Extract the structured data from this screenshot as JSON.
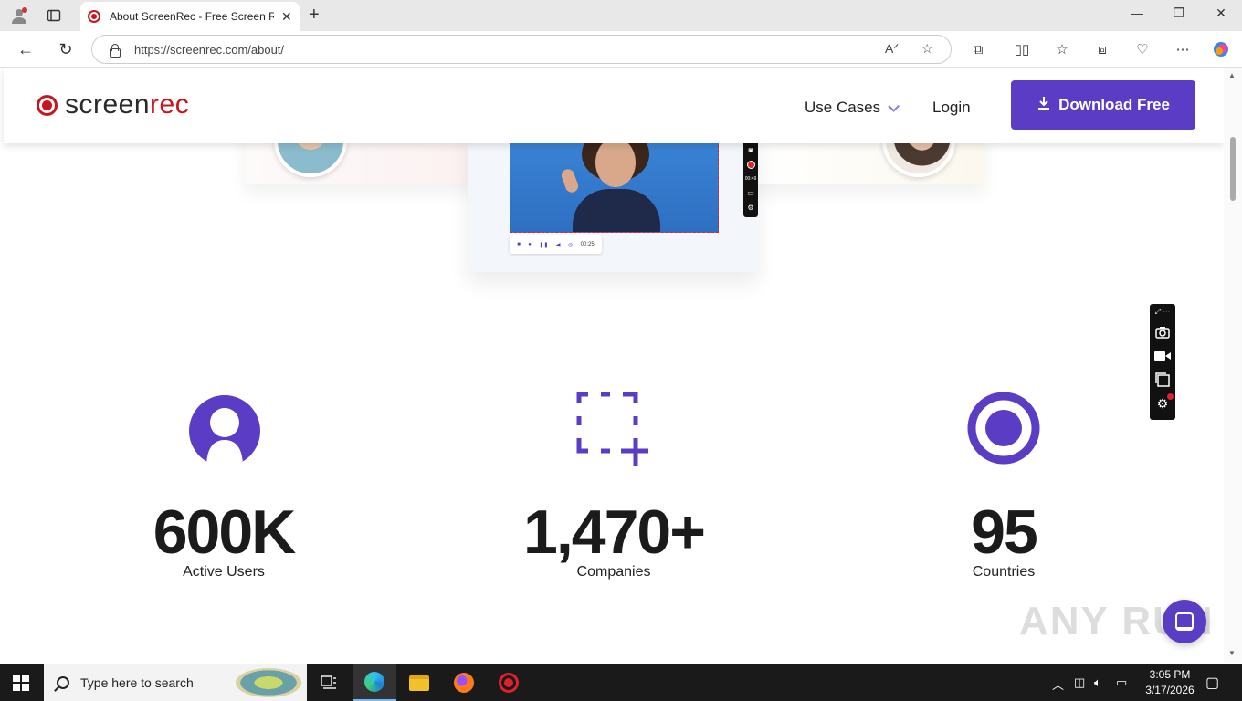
{
  "browser": {
    "tab_title": "About ScreenRec - Free Screen Re",
    "url": "https://screenrec.com/about/",
    "new_tab": "+",
    "window_controls": [
      "—",
      "❐",
      "✕"
    ]
  },
  "site": {
    "logo_left": "screen",
    "logo_right": "rec",
    "nav": {
      "use_cases": "Use Cases",
      "login": "Login",
      "download": "Download Free"
    }
  },
  "hero": {
    "mini_timer": "00:49",
    "ctrl_time": "00:25"
  },
  "stats": [
    {
      "number": "600K",
      "label": "Active Users",
      "icon": "user-icon"
    },
    {
      "number": "1,470+",
      "label": "Companies",
      "icon": "selection-add-icon"
    },
    {
      "number": "95",
      "label": "Countries",
      "icon": "record-dot-icon"
    }
  ],
  "watermark": "ANY RUN",
  "taskbar": {
    "search_placeholder": "Type here to search",
    "time": "3:05 PM",
    "date": "3/17/2026"
  },
  "colors": {
    "brand_red": "#c8141c",
    "brand_purple": "#5b3cc4"
  }
}
